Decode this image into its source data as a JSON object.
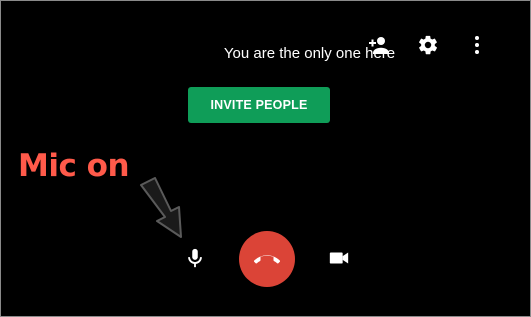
{
  "status": {
    "message": "You are the only one here"
  },
  "actions": {
    "invite_label": "INVITE PEOPLE"
  },
  "annotation": {
    "label": "Mic on"
  },
  "top_bar": {
    "icons": [
      "add-person-icon",
      "settings-gear-icon",
      "more-vert-icon"
    ]
  },
  "call_controls": {
    "mic": {
      "icon": "microphone-icon",
      "state": "on"
    },
    "hangup": {
      "icon": "hang-up-phone-icon"
    },
    "camera": {
      "icon": "video-camera-icon"
    }
  },
  "colors": {
    "background": "#000000",
    "invite_button": "#0f9d58",
    "hangup_button": "#db4437",
    "annotation_text": "#ff5a4a"
  }
}
